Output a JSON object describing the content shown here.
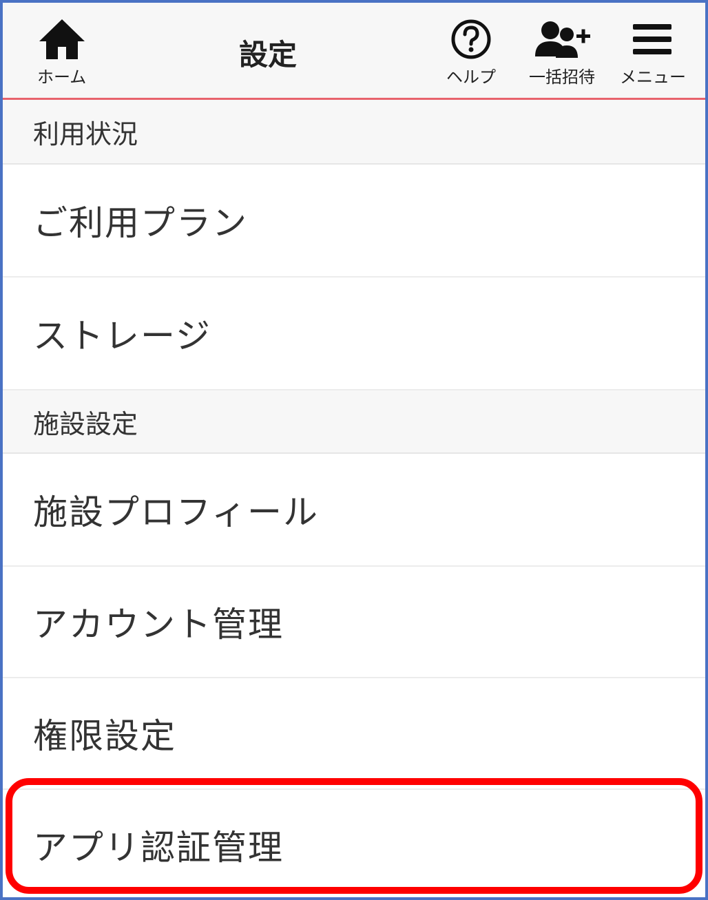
{
  "header": {
    "title": "設定",
    "accent_color": "#e8636c",
    "home": {
      "label": "ホーム",
      "icon": "home-icon"
    },
    "help": {
      "label": "ヘルプ",
      "icon": "question-circle-icon"
    },
    "invite": {
      "label": "一括招待",
      "icon": "add-users-icon"
    },
    "menu": {
      "label": "メニュー",
      "icon": "hamburger-icon"
    }
  },
  "sections": [
    {
      "title": "利用状況",
      "items": [
        {
          "label": "ご利用プラン"
        },
        {
          "label": "ストレージ"
        }
      ]
    },
    {
      "title": "施設設定",
      "items": [
        {
          "label": "施設プロフィール"
        },
        {
          "label": "アカウント管理"
        },
        {
          "label": "権限設定"
        },
        {
          "label": "アプリ認証管理"
        }
      ]
    }
  ],
  "highlight_color": "#ff0000",
  "frame_color": "#4a72c4"
}
